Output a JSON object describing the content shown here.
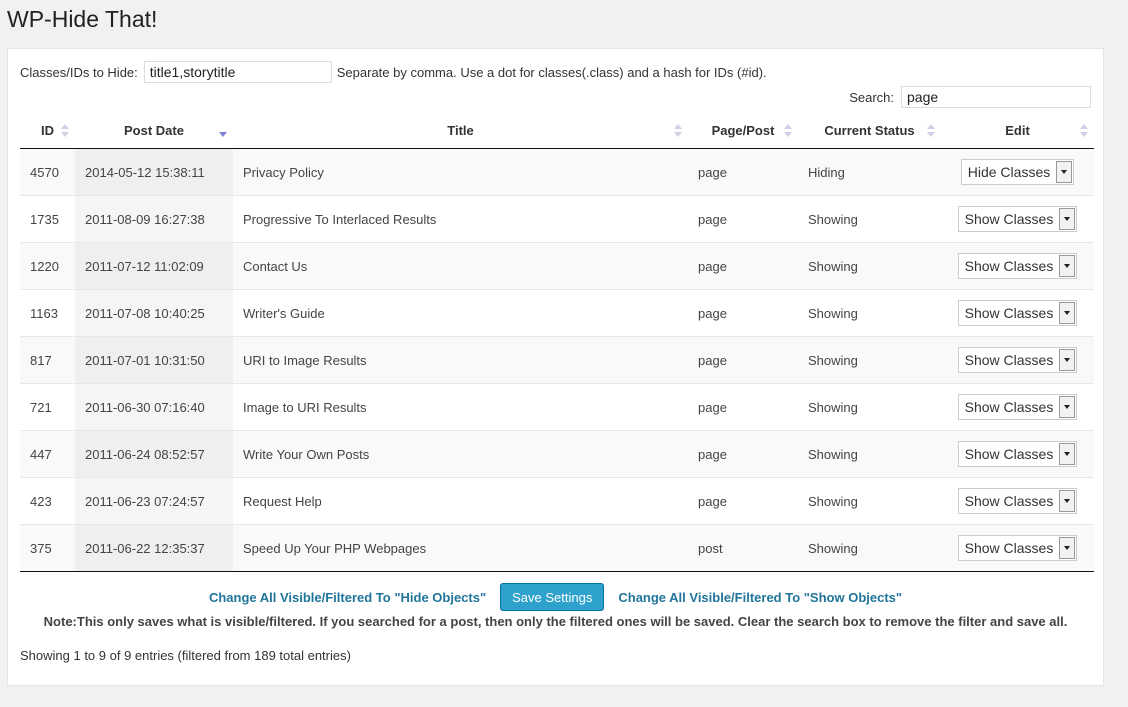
{
  "page_title": "WP-Hide That!",
  "hide": {
    "label": "Classes/IDs to Hide:",
    "value": "title1,storytitle",
    "help": "Separate by comma. Use a dot for classes(.class) and a hash for IDs (#id)."
  },
  "search": {
    "label": "Search:",
    "value": "page"
  },
  "columns": [
    "ID",
    "Post Date",
    "Title",
    "Page/Post",
    "Current Status",
    "Edit"
  ],
  "rows": [
    {
      "id": "4570",
      "date": "2014-05-12 15:38:11",
      "title": "Privacy Policy",
      "type": "page",
      "status": "Hiding",
      "edit": "Hide Classes"
    },
    {
      "id": "1735",
      "date": "2011-08-09 16:27:38",
      "title": "Progressive To Interlaced Results",
      "type": "page",
      "status": "Showing",
      "edit": "Show Classes"
    },
    {
      "id": "1220",
      "date": "2011-07-12 11:02:09",
      "title": "Contact Us",
      "type": "page",
      "status": "Showing",
      "edit": "Show Classes"
    },
    {
      "id": "1163",
      "date": "2011-07-08 10:40:25",
      "title": "Writer's Guide",
      "type": "page",
      "status": "Showing",
      "edit": "Show Classes"
    },
    {
      "id": "817",
      "date": "2011-07-01 10:31:50",
      "title": "URI to Image Results",
      "type": "page",
      "status": "Showing",
      "edit": "Show Classes"
    },
    {
      "id": "721",
      "date": "2011-06-30 07:16:40",
      "title": "Image to URI Results",
      "type": "page",
      "status": "Showing",
      "edit": "Show Classes"
    },
    {
      "id": "447",
      "date": "2011-06-24 08:52:57",
      "title": "Write Your Own Posts",
      "type": "page",
      "status": "Showing",
      "edit": "Show Classes"
    },
    {
      "id": "423",
      "date": "2011-06-23 07:24:57",
      "title": "Request Help",
      "type": "page",
      "status": "Showing",
      "edit": "Show Classes"
    },
    {
      "id": "375",
      "date": "2011-06-22 12:35:37",
      "title": "Speed Up Your PHP Webpages",
      "type": "post",
      "status": "Showing",
      "edit": "Show Classes"
    }
  ],
  "actions": {
    "hide_all": "Change All Visible/Filtered To \"Hide Objects\"",
    "save": "Save Settings",
    "show_all": "Change All Visible/Filtered To \"Show Objects\""
  },
  "note": "Note:This only saves what is visible/filtered. If you searched for a post, then only the filtered ones will be saved. Clear the search box to remove the filter and save all.",
  "info": "Showing 1 to 9 of 9 entries (filtered from 189 total entries)",
  "colors": {
    "link": "#21759b",
    "button": "#2ea2cc",
    "sort_active": "#7f7fd9"
  }
}
